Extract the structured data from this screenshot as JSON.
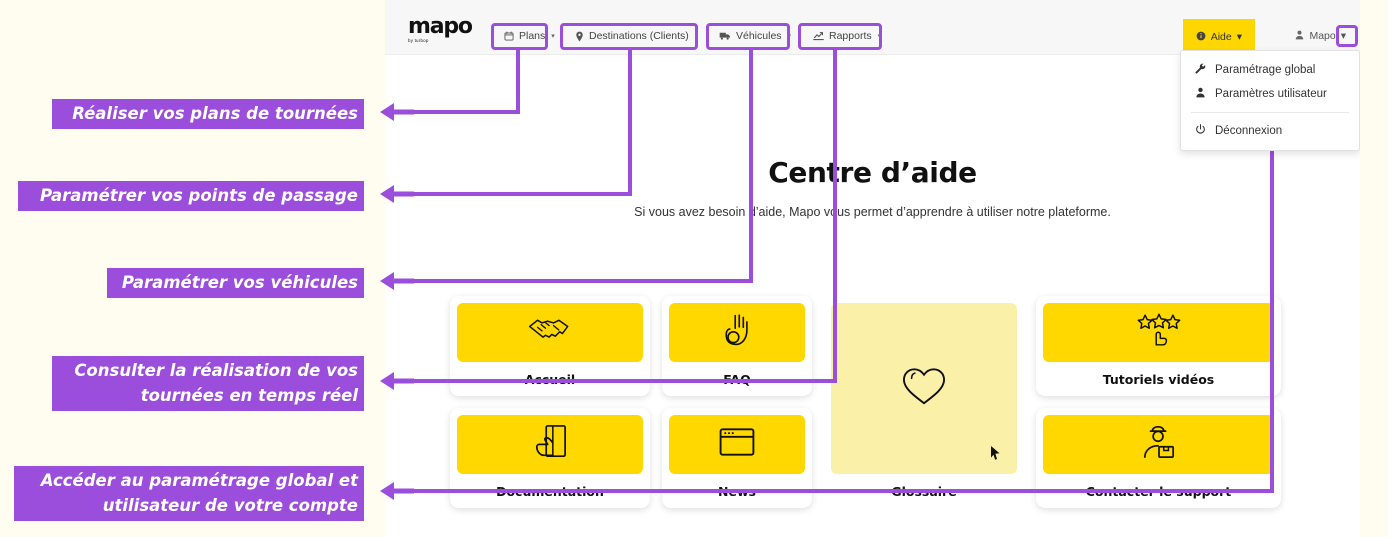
{
  "app": {
    "logo": {
      "word": "mapo",
      "sub": "by turbop"
    },
    "nav": [
      {
        "id": "plans",
        "label": "Plans",
        "icon": "calendar-icon",
        "caret": "▾"
      },
      {
        "id": "destinations",
        "label": "Destinations (Clients)",
        "icon": "map-pin-icon",
        "caret": "▾"
      },
      {
        "id": "vehicules",
        "label": "Véhicules",
        "icon": "truck-icon",
        "caret": "▾"
      },
      {
        "id": "rapports",
        "label": "Rapports",
        "icon": "chart-icon",
        "caret": "▾"
      }
    ],
    "aide": {
      "label": "Aide",
      "icon": "info-icon",
      "caret": "▾"
    },
    "user": {
      "label": "Mapo",
      "icon": "person-icon",
      "caret": "▾"
    },
    "dropdown": {
      "items": [
        {
          "label": "Paramétrage global",
          "icon": "wrench-icon"
        },
        {
          "label": "Paramètres utilisateur",
          "icon": "person-icon"
        },
        {
          "label": "Déconnexion",
          "icon": "power-icon"
        }
      ]
    }
  },
  "page": {
    "title": "Centre d’aide",
    "subtitle": "Si vous avez besoin d’aide, Mapo vous permet d’apprendre à utiliser notre plateforme."
  },
  "cards": [
    {
      "label": "Accueil",
      "icon": "handshake-icon"
    },
    {
      "label": "FAQ",
      "icon": "ok-hand-icon"
    },
    {
      "label": "Glossaire",
      "icon": "heart-icon",
      "state": "hover"
    },
    {
      "label": "Tutoriels vidéos",
      "icon": "stars-rating-icon"
    },
    {
      "label": "Documentation",
      "icon": "hand-book-icon"
    },
    {
      "label": "News",
      "icon": "browser-window-icon"
    },
    {
      "label": "Contacter le support",
      "icon": "support-agent-icon"
    }
  ],
  "annotations": [
    {
      "id": "plans",
      "text": "Réaliser vos plans de tournées"
    },
    {
      "id": "destinations",
      "text": "Paramétrer vos points de passage"
    },
    {
      "id": "vehicules",
      "text": "Paramétrer vos véhicules"
    },
    {
      "id": "rapports",
      "text": "Consulter la réalisation de vos\ntournées en temps réel"
    },
    {
      "id": "parametrage",
      "text": "Accéder au paramétrage global et\nutilisateur de votre compte"
    }
  ],
  "colors": {
    "accent_purple": "#9b4ddb",
    "brand_yellow": "#ffd800",
    "page_background": "#fffdf0",
    "tile_hover": "#fbf0a8"
  }
}
